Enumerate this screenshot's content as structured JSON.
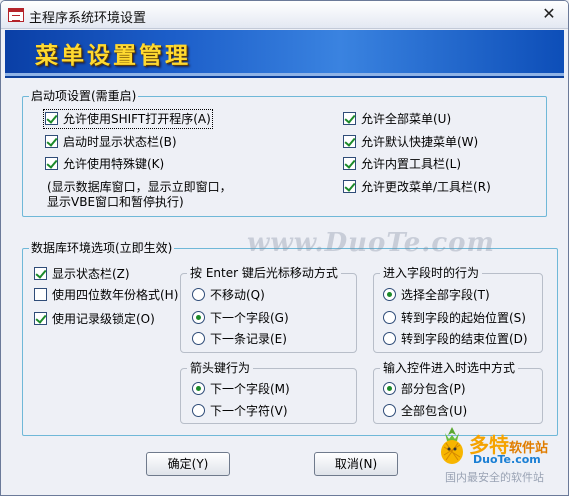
{
  "window": {
    "title": "主程序系统环境设置",
    "close_symbol": "✕"
  },
  "banner": {
    "title": "菜单设置管理"
  },
  "startup": {
    "legend": "启动项设置(需重启)",
    "left_items": [
      {
        "label": "允许使用SHIFT打开程序(A)",
        "checked": true
      },
      {
        "label": "启动时显示状态栏(B)",
        "checked": true
      },
      {
        "label": "允许使用特殊键(K)",
        "checked": true
      }
    ],
    "note_line1": "(显示数据库窗口，显示立即窗口，",
    "note_line2": "显示VBE窗口和暂停执行)",
    "right_items": [
      {
        "label": "允许全部菜单(U)",
        "checked": true
      },
      {
        "label": "允许默认快捷菜单(W)",
        "checked": true
      },
      {
        "label": "允许内置工具栏(L)",
        "checked": true
      },
      {
        "label": "允许更改菜单/工具栏(R)",
        "checked": true
      }
    ]
  },
  "environment": {
    "legend": "数据库环境选项(立即生效)",
    "checks": [
      {
        "label": "显示状态栏(Z)",
        "checked": true
      },
      {
        "label": "使用四位数年份格式(H)",
        "checked": false
      },
      {
        "label": "使用记录级锁定(O)",
        "checked": true
      }
    ],
    "enter_move": {
      "legend": "按 Enter 键后光标移动方式",
      "options": [
        {
          "label": "不移动(Q)",
          "checked": false
        },
        {
          "label": "下一个字段(G)",
          "checked": true
        },
        {
          "label": "下一条记录(E)",
          "checked": false
        }
      ]
    },
    "field_entry": {
      "legend": "进入字段时的行为",
      "options": [
        {
          "label": "选择全部字段(T)",
          "checked": true
        },
        {
          "label": "转到字段的起始位置(S)",
          "checked": false
        },
        {
          "label": "转到字段的结束位置(D)",
          "checked": false
        }
      ]
    },
    "arrow_key": {
      "legend": "箭头键行为",
      "options": [
        {
          "label": "下一个字段(M)",
          "checked": true
        },
        {
          "label": "下一个字符(V)",
          "checked": false
        }
      ]
    },
    "input_select": {
      "legend": "输入控件进入时选中方式",
      "options": [
        {
          "label": "部分包含(P)",
          "checked": true
        },
        {
          "label": "全部包含(U)",
          "checked": false
        }
      ]
    }
  },
  "buttons": {
    "ok": "确定(Y)",
    "cancel": "取消(N)"
  },
  "watermarks": {
    "center": "www.DuoTe.com",
    "logo_title": "多特",
    "logo_subtitle": "软件站",
    "logo_site": "DuoTe.com",
    "logo_slogan": "国内最安全的软件站"
  },
  "colors": {
    "banner_text": "#ffd930",
    "check_mark": "#1c8a2a",
    "group_border": "#6fb8d8"
  }
}
